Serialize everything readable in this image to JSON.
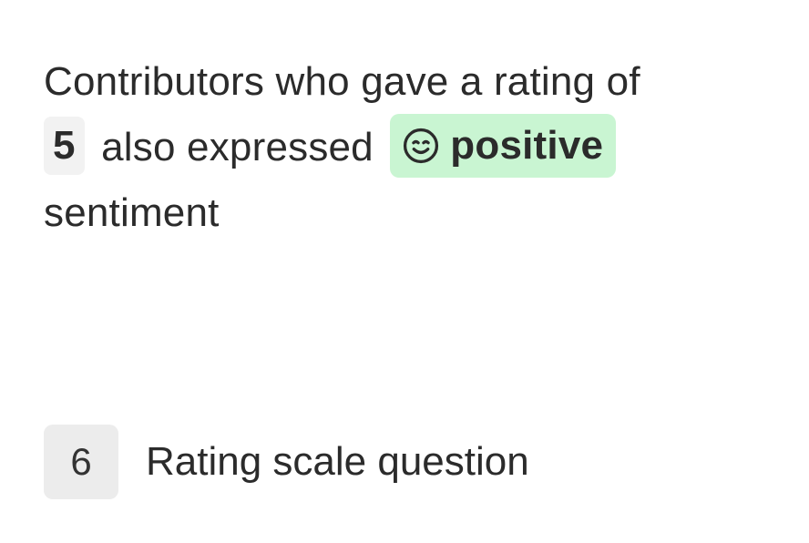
{
  "insight": {
    "text_before": "Contributors who gave a rating of",
    "rating_value": "5",
    "text_middle": "also expressed",
    "sentiment_label": "positive",
    "sentiment_icon": "smiley-face-icon",
    "sentiment_color": "#c9f5d2",
    "text_after": "sentiment"
  },
  "question": {
    "number": "6",
    "label": "Rating scale question"
  }
}
